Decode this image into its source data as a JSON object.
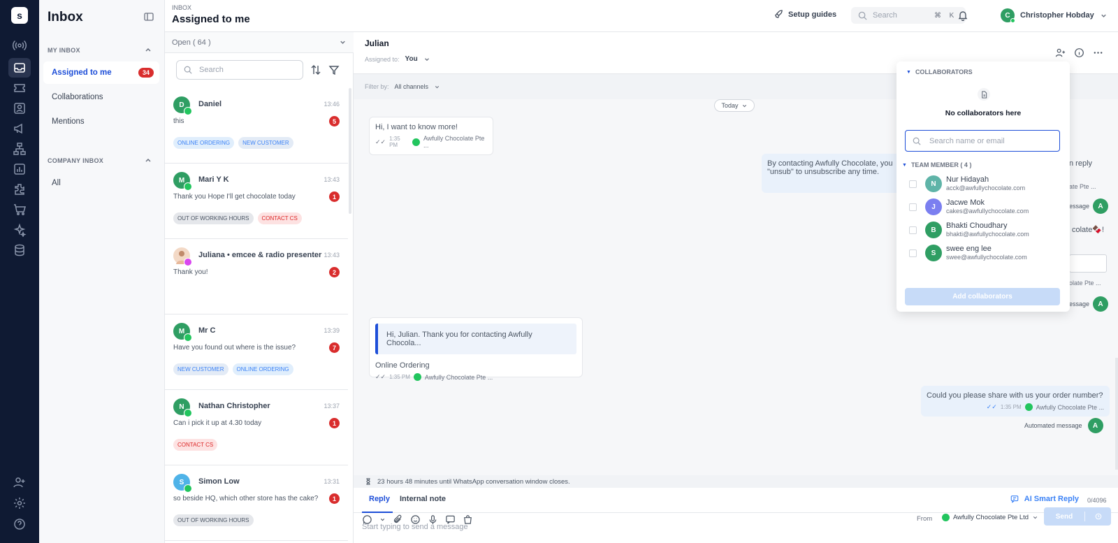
{
  "sidebar": {
    "title": "Inbox",
    "my_inbox_header": "MY INBOX",
    "company_inbox_header": "COMPANY INBOX",
    "items": [
      {
        "label": "Assigned to me",
        "badge": "34"
      },
      {
        "label": "Collaborations"
      },
      {
        "label": "Mentions"
      }
    ],
    "company_items": [
      {
        "label": "All"
      }
    ]
  },
  "topbar": {
    "breadcrumb": "INBOX",
    "title": "Assigned to me",
    "setup_guides": "Setup guides",
    "search_placeholder": "Search",
    "kbd_cmd": "⌘",
    "kbd_k": "K",
    "user_initial": "C",
    "user_name": "Christopher Hobday"
  },
  "list": {
    "filter": "Open ( 64 )",
    "search_placeholder": "Search",
    "conversations": [
      {
        "initial": "D",
        "name": "Daniel",
        "time": "13:46",
        "message": "this",
        "unread": "5",
        "tags": [
          "ONLINE ORDERING",
          "NEW CUSTOMER"
        ]
      },
      {
        "initial": "M",
        "name": "Mari Y K",
        "time": "13:43",
        "message": "Thank you Hope I'll get chocolate today",
        "unread": "1",
        "tags": [
          "OUT OF WORKING HOURS",
          "CONTACT CS"
        ]
      },
      {
        "initial": "",
        "name": "Juliana • emcee & radio presenter",
        "time": "13:43",
        "message": "Thank you!",
        "unread": "2",
        "tags": []
      },
      {
        "initial": "M",
        "name": "Mr C",
        "time": "13:39",
        "message": "Have you found out where is the issue?",
        "unread": "7",
        "tags": [
          "NEW CUSTOMER",
          "ONLINE ORDERING"
        ]
      },
      {
        "initial": "N",
        "name": "Nathan Christopher",
        "time": "13:37",
        "message": "Can i pick it up at 4.30 today",
        "unread": "1",
        "tags": [
          "CONTACT CS"
        ]
      },
      {
        "initial": "S",
        "name": "Simon Low",
        "time": "13:31",
        "message": "so beside HQ, which other store has the cake?",
        "unread": "1",
        "tags": [
          "OUT OF WORKING HOURS"
        ]
      }
    ]
  },
  "chat": {
    "contact_name": "Julian",
    "assigned_label": "Assigned to:",
    "assigned_value": "You",
    "filter_label": "Filter by:",
    "filter_value": "All channels",
    "date_divider": "Today",
    "messages": [
      {
        "text": "Hi, I want to know more!",
        "time": "1:35 PM",
        "channel": "Awfully Chocolate Pte ..."
      },
      {
        "text": "By contacting Awfully Chocolate, you",
        "text2": "\"unsub\" to unsubscribe any time.",
        "tail": "n reply",
        "channel": "ate Pte ..."
      },
      {
        "quote": "Hi, Julian. Thank you for contacting Awfully Chocola...",
        "text": "Online Ordering",
        "time": "1:35 PM",
        "channel": "Awfully Chocolate Pte ..."
      },
      {
        "text": "Could you please share with us your order number?",
        "time": "1:35 PM",
        "channel": "Awfully Chocolate Pte ..."
      }
    ],
    "partial_out_2": "colate🍫!",
    "partial_out_3": "olate Pte ...",
    "automated_label": "Automated message",
    "partial_auto": "essage",
    "bot_initial": "A",
    "window_notice": "23 hours 48 minutes until WhatsApp conversation window closes.",
    "tab_reply": "Reply",
    "tab_note": "Internal note",
    "ai_reply": "AI Smart Reply",
    "composer_placeholder": "Start typing to send a message",
    "char_count": "0/4096",
    "from_label": "From",
    "from_value": "Awfully Chocolate Pte Ltd",
    "send": "Send"
  },
  "collaborators": {
    "header": "COLLABORATORS",
    "empty": "No collaborators here",
    "search_placeholder": "Search name or email",
    "team_header": "TEAM MEMBER ( 4 )",
    "members": [
      {
        "initial": "N",
        "name": "Nur Hidayah",
        "email": "acck@awfullychocolate.com",
        "color": "#5fb4a8"
      },
      {
        "initial": "J",
        "name": "Jacwe Mok",
        "email": "cakes@awfullychocolate.com",
        "color": "#7b7ff0"
      },
      {
        "initial": "B",
        "name": "Bhakti Choudhary",
        "email": "bhakti@awfullychocolate.com",
        "color": "#2f9e63"
      },
      {
        "initial": "S",
        "name": "swee eng lee",
        "email": "swee@awfullychocolate.com",
        "color": "#2f9e63"
      }
    ],
    "add_button": "Add collaborators"
  },
  "colors": {
    "accent": "#1d4ed8",
    "rail": "#0f1a33",
    "unread": "#d92d2d",
    "whatsapp": "#22c55e"
  }
}
